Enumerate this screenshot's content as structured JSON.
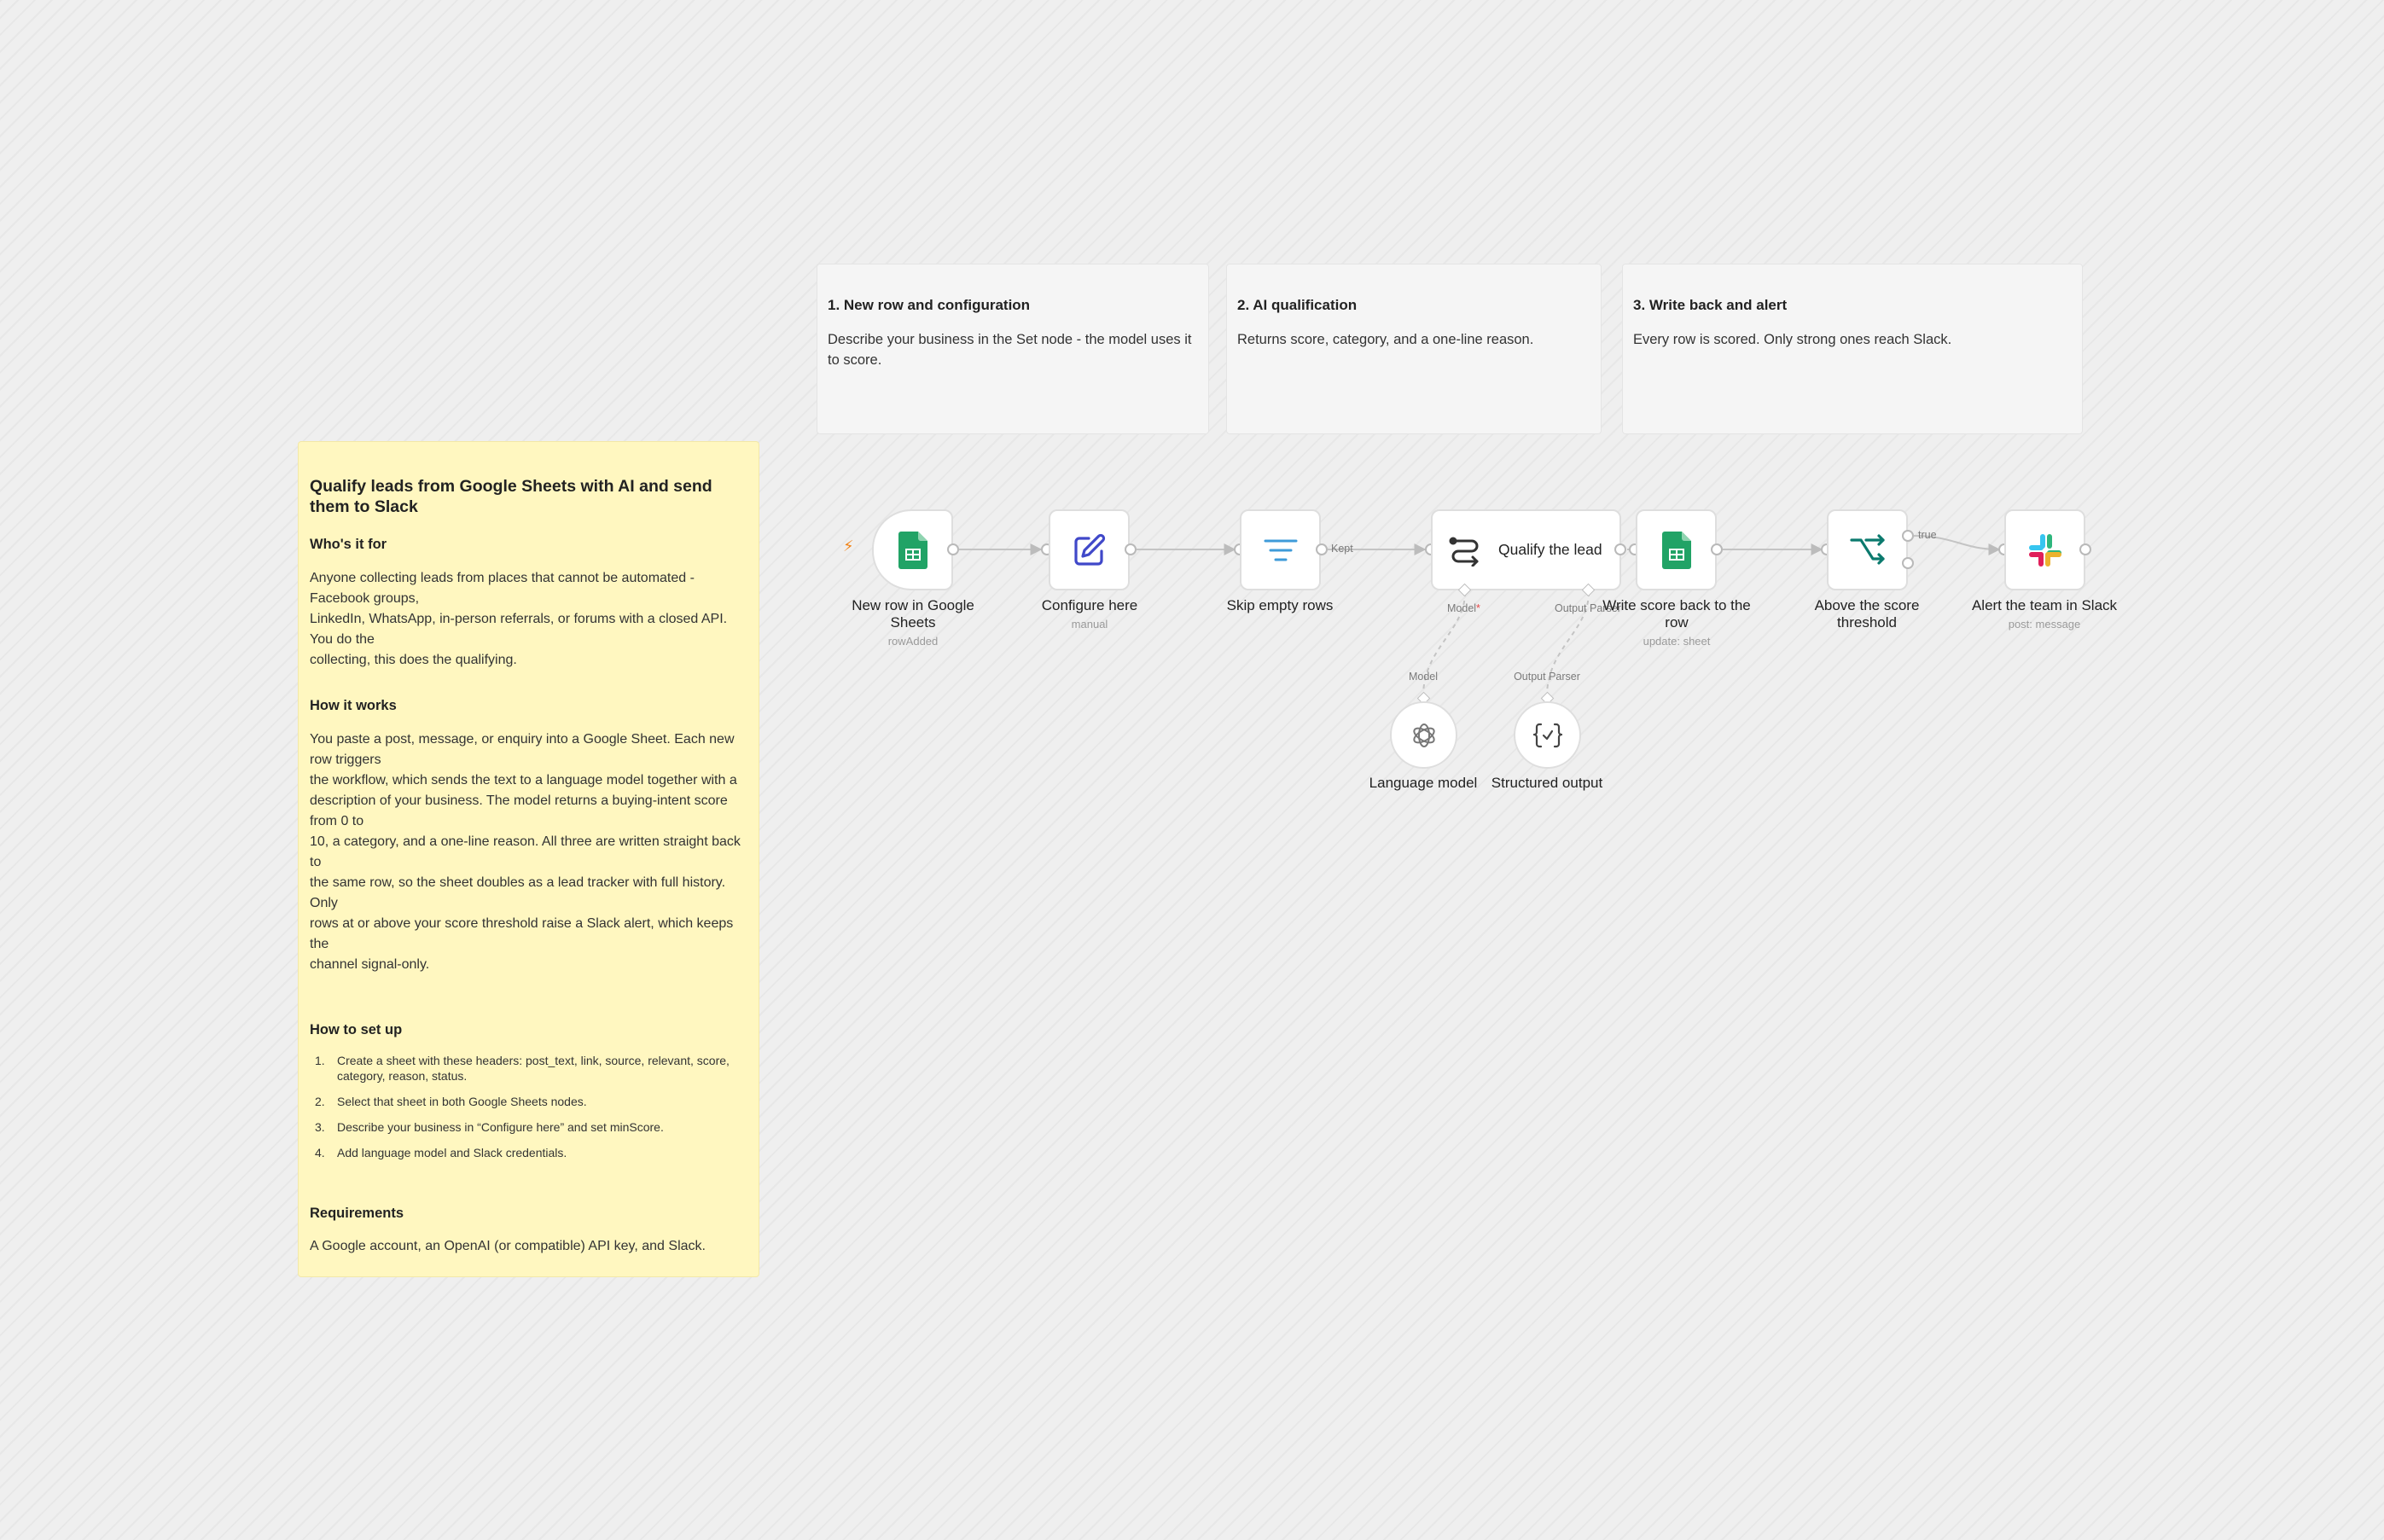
{
  "sections": [
    {
      "title": "1. New row and configuration",
      "body": "Describe your business in the Set node - the model uses it to score."
    },
    {
      "title": "2. AI qualification",
      "body": "Returns score, category, and a one-line reason."
    },
    {
      "title": "3. Write back and alert",
      "body": "Every row is scored. Only strong ones reach Slack."
    }
  ],
  "main_note": {
    "title": "Qualify leads from Google Sheets with AI and send them to Slack",
    "who_heading": "Who's it for",
    "who_text": "Anyone collecting leads from places that cannot be automated - Facebook groups,\nLinkedIn, WhatsApp, in-person referrals, or forums with a closed API. You do the\ncollecting, this does the qualifying.",
    "how_heading": "How it works",
    "how_text": "You paste a post, message, or enquiry into a Google Sheet. Each new row triggers\nthe workflow, which sends the text to a language model together with a\ndescription of your business. The model returns a buying-intent score from 0 to\n10, a category, and a one-line reason. All three are written straight back to\nthe same row, so the sheet doubles as a lead tracker with full history. Only\nrows at or above your score threshold raise a Slack alert, which keeps the\nchannel signal-only.",
    "setup_heading": "How to set up",
    "steps": [
      {
        "num": "1.",
        "text": "Create a sheet with these headers: post_text, link, source, relevant, score,\ncategory, reason, status."
      },
      {
        "num": "2.",
        "text": "Select that sheet in both Google Sheets nodes."
      },
      {
        "num": "3.",
        "text": "Describe your business in “Configure here” and set minScore."
      },
      {
        "num": "4.",
        "text": "Add language model and Slack credentials."
      }
    ],
    "req_heading": "Requirements",
    "req_text": "A Google account, an OpenAI (or compatible) API key, and Slack."
  },
  "nodes": {
    "trigger": {
      "label": "New row in Google\nSheets",
      "sub": "rowAdded",
      "icon": "google-sheets-icon"
    },
    "configure": {
      "label": "Configure here",
      "sub": "manual",
      "icon": "edit-pencil-icon"
    },
    "filter": {
      "label": "Skip empty rows",
      "icon": "filter-icon"
    },
    "agent": {
      "label": "Qualify the lead",
      "icon": "ai-agent-icon"
    },
    "write": {
      "label": "Write score back to the\nrow",
      "sub": "update: sheet",
      "icon": "google-sheets-icon"
    },
    "if": {
      "label": "Above the score\nthreshold",
      "icon": "if-branch-icon"
    },
    "slack": {
      "label": "Alert the team in Slack",
      "sub": "post: message",
      "icon": "slack-icon"
    },
    "model": {
      "label": "Language model",
      "icon": "openai-icon"
    },
    "parser": {
      "label": "Structured output",
      "icon": "json-braces-icon"
    }
  },
  "connections": {
    "kept": "Kept",
    "true": "true",
    "model_port": "Model",
    "model_required": "*",
    "parser_port": "Output Parser",
    "model_in": "Model",
    "parser_in": "Output Parser"
  },
  "colors": {
    "sheets_green": "#21a366",
    "edit_blue": "#4048c9",
    "filter_blue": "#3f9bd9",
    "if_teal": "#0b7a6e",
    "trigger_orange": "#f0841a",
    "required_red": "#e54848"
  }
}
